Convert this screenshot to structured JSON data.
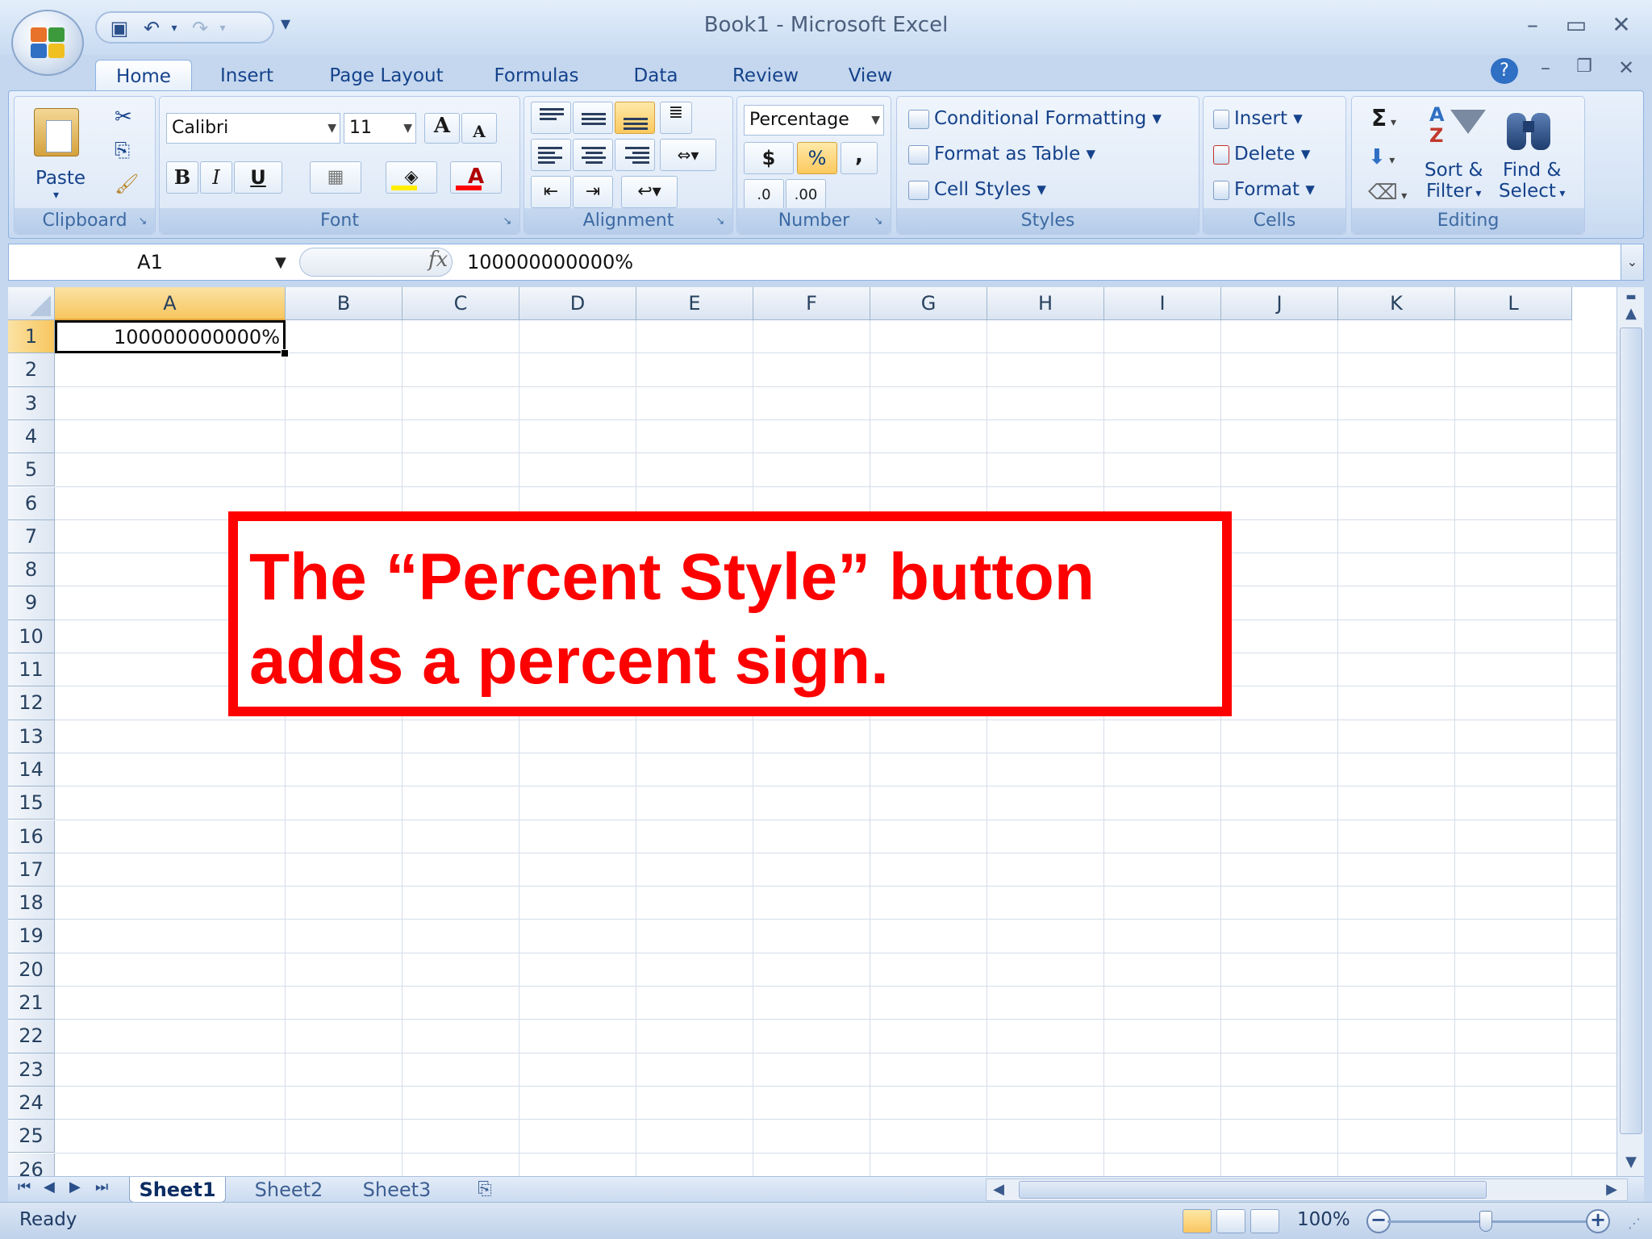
{
  "window": {
    "title": "Book1 - Microsoft Excel",
    "controls": {
      "minimize": "–",
      "maximize": "▭",
      "close": "✕"
    },
    "app_controls": {
      "help": "?",
      "minimize": "–",
      "restore": "❐",
      "close": "✕"
    }
  },
  "quick_access": {
    "save_icon": "save-icon",
    "undo_icon": "undo-icon",
    "redo_icon": "redo-icon",
    "customize": "▾"
  },
  "tabs": [
    "Home",
    "Insert",
    "Page Layout",
    "Formulas",
    "Data",
    "Review",
    "View"
  ],
  "active_tab": "Home",
  "ribbon": {
    "clipboard": {
      "label": "Clipboard",
      "paste": "Paste"
    },
    "font": {
      "label": "Font",
      "name": "Calibri",
      "size": "11",
      "bold": "B",
      "italic": "I",
      "underline": "U",
      "grow": "A",
      "shrink": "A",
      "font_color": "A"
    },
    "alignment": {
      "label": "Alignment"
    },
    "number": {
      "label": "Number",
      "format": "Percentage",
      "currency": "$",
      "percent": "%",
      "comma": ",",
      "increase_decimal": ".0",
      "decrease_decimal": ".00"
    },
    "styles": {
      "label": "Styles",
      "conditional": "Conditional Formatting",
      "format_table": "Format as Table",
      "cell_styles": "Cell Styles"
    },
    "cells": {
      "label": "Cells",
      "insert": "Insert",
      "delete": "Delete",
      "format": "Format"
    },
    "editing": {
      "label": "Editing",
      "sum": "Σ",
      "sort_filter_line1": "Sort &",
      "sort_filter_line2": "Filter",
      "find_select_line1": "Find &",
      "find_select_line2": "Select"
    }
  },
  "formula_bar": {
    "name_box": "A1",
    "fx": "fx",
    "value": "100000000000%"
  },
  "grid": {
    "columns": [
      "A",
      "B",
      "C",
      "D",
      "E",
      "F",
      "G",
      "H",
      "I",
      "J",
      "K",
      "L"
    ],
    "rows": [
      "1",
      "2",
      "3",
      "4",
      "5",
      "6",
      "7",
      "8",
      "9",
      "10",
      "11",
      "12",
      "13",
      "14",
      "15",
      "16",
      "17",
      "18",
      "19",
      "20",
      "21",
      "22",
      "23",
      "24",
      "25",
      "26"
    ],
    "cells": {
      "A1": "100000000000%"
    },
    "selected_cell": "A1"
  },
  "sheets": [
    "Sheet1",
    "Sheet2",
    "Sheet3"
  ],
  "active_sheet": "Sheet1",
  "status": {
    "text": "Ready",
    "zoom": "100%"
  },
  "callout": {
    "line1": "The “Percent Style” button",
    "line2": "adds a percent sign."
  },
  "colors": {
    "accent_red": "#fe0000",
    "ribbon_text": "#15428b",
    "selection": "#f7c65f"
  }
}
